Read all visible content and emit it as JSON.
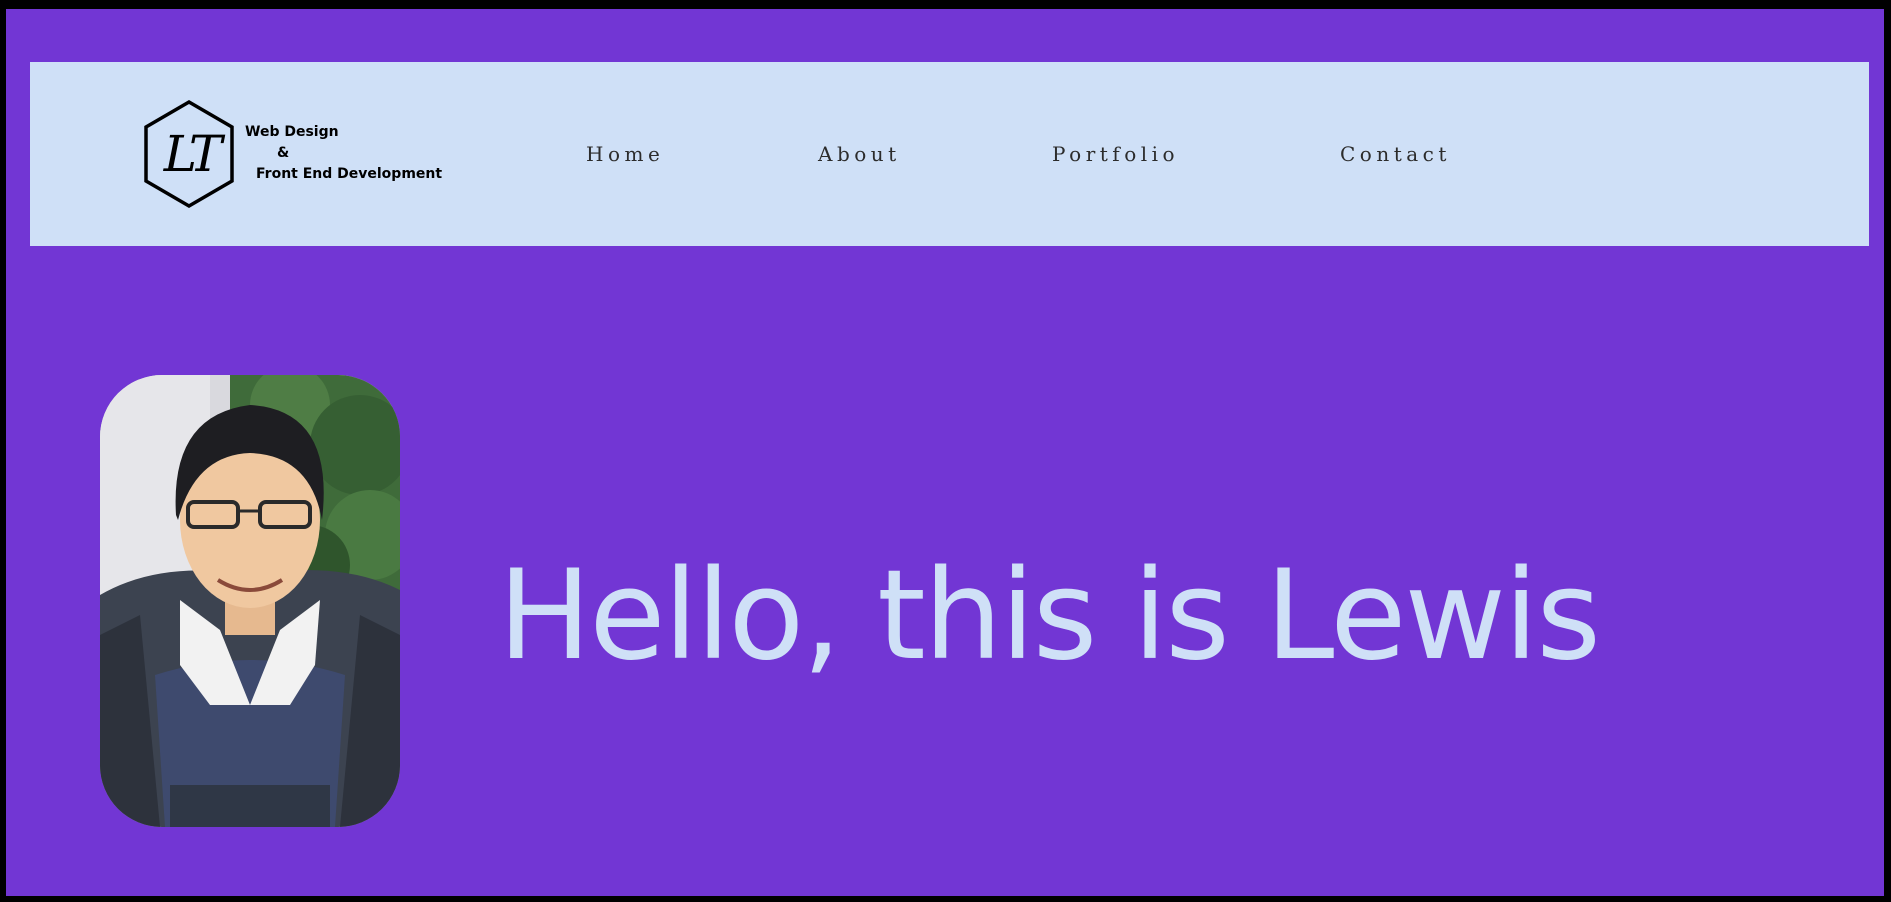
{
  "header": {
    "logo_alt": "LT",
    "tagline": {
      "line1": "Web Design",
      "line2": "&",
      "line3": "Front End Development"
    },
    "nav": [
      {
        "label": "Home"
      },
      {
        "label": "About"
      },
      {
        "label": "Portfolio"
      },
      {
        "label": "Contact"
      }
    ]
  },
  "hero": {
    "title": "Hello, this is Lewis",
    "photo_icon": "profile-photo"
  },
  "colors": {
    "background": "#7236d4",
    "header_bg": "#cfe0f7",
    "title_text": "#cfe0f7",
    "frame": "#000000"
  }
}
